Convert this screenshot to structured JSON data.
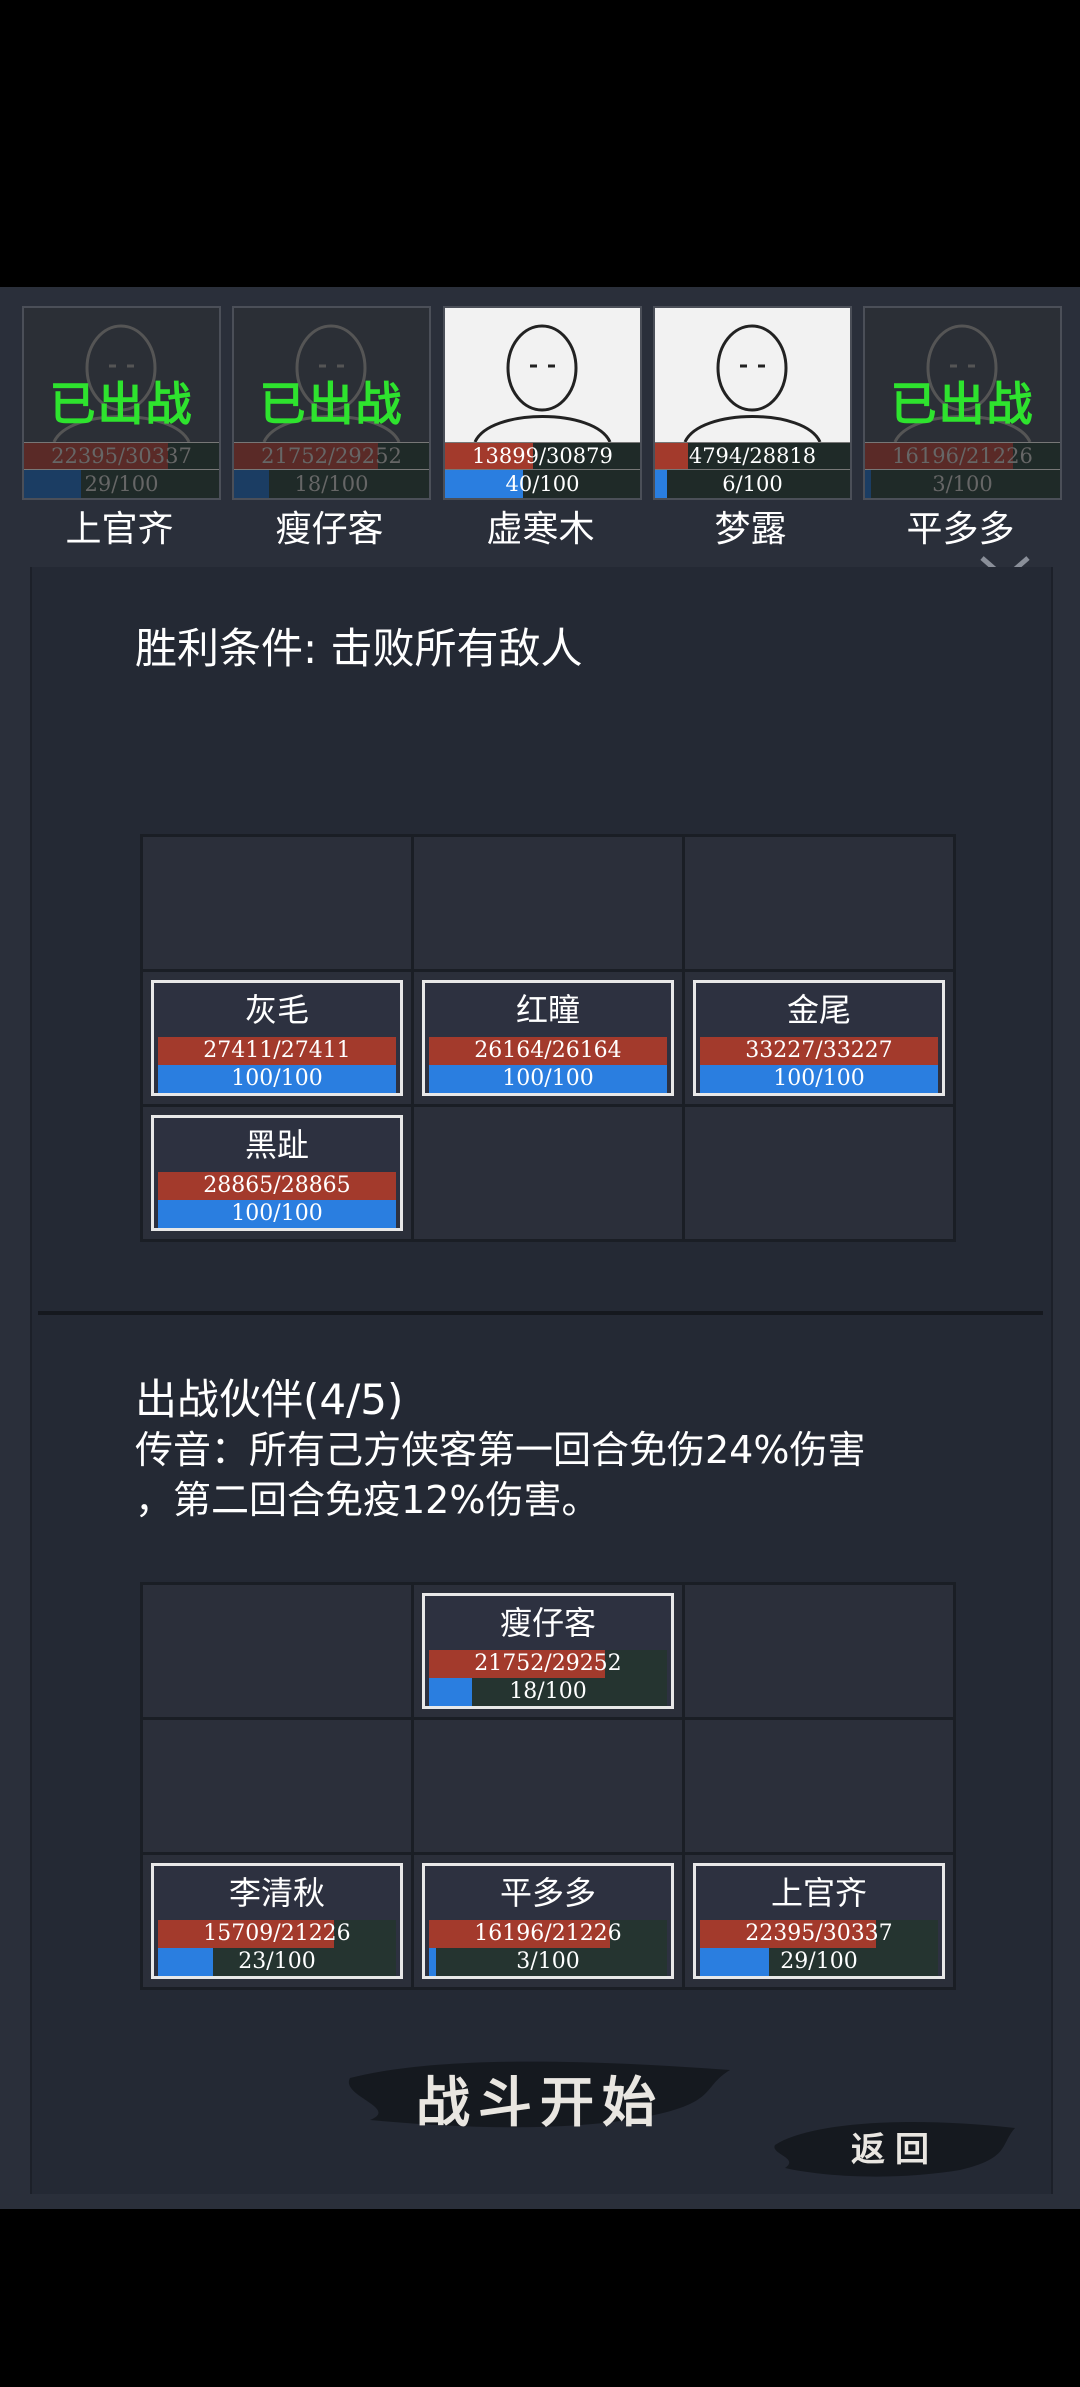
{
  "roster": [
    {
      "name": "上官齐",
      "hp": "22395/30337",
      "hp_frac": 0.74,
      "rage": "29/100",
      "rage_frac": 0.29,
      "deployed": true,
      "stamp": "已出战"
    },
    {
      "name": "瘦仔客",
      "hp": "21752/29252",
      "hp_frac": 0.74,
      "rage": "18/100",
      "rage_frac": 0.18,
      "deployed": true,
      "stamp": "已出战"
    },
    {
      "name": "虚寒木",
      "hp": "13899/30879",
      "hp_frac": 0.45,
      "rage": "40/100",
      "rage_frac": 0.4,
      "deployed": false,
      "stamp": ""
    },
    {
      "name": "梦露",
      "hp": "4794/28818",
      "hp_frac": 0.17,
      "rage": "6/100",
      "rage_frac": 0.06,
      "deployed": false,
      "stamp": ""
    },
    {
      "name": "平多多",
      "hp": "16196/21226",
      "hp_frac": 0.76,
      "rage": "3/100",
      "rage_frac": 0.03,
      "deployed": true,
      "stamp": "已出战"
    }
  ],
  "victory": {
    "text": "胜利条件: 击败所有敌人"
  },
  "enemies": [
    null,
    null,
    null,
    {
      "name": "灰毛",
      "hp": "27411/27411",
      "hp_frac": 1.0,
      "rage": "100/100",
      "rage_frac": 1.0
    },
    {
      "name": "红瞳",
      "hp": "26164/26164",
      "hp_frac": 1.0,
      "rage": "100/100",
      "rage_frac": 1.0
    },
    {
      "name": "金尾",
      "hp": "33227/33227",
      "hp_frac": 1.0,
      "rage": "100/100",
      "rage_frac": 1.0
    },
    {
      "name": "黑趾",
      "hp": "28865/28865",
      "hp_frac": 1.0,
      "rage": "100/100",
      "rage_frac": 1.0
    },
    null,
    null
  ],
  "party": {
    "title": "出战伙伴(4/5)",
    "buff_line1": "传音：所有己方侠客第一回合免伤24%伤害",
    "buff_line2": "，第二回合免疫12%伤害。"
  },
  "allies": [
    null,
    {
      "name": "瘦仔客",
      "hp": "21752/29252",
      "hp_frac": 0.74,
      "rage": "18/100",
      "rage_frac": 0.18
    },
    null,
    null,
    null,
    null,
    {
      "name": "李清秋",
      "hp": "15709/21226",
      "hp_frac": 0.74,
      "rage": "23/100",
      "rage_frac": 0.23
    },
    {
      "name": "平多多",
      "hp": "16196/21226",
      "hp_frac": 0.76,
      "rage": "3/100",
      "rage_frac": 0.03
    },
    {
      "name": "上官齐",
      "hp": "22395/30337",
      "hp_frac": 0.74,
      "rage": "29/100",
      "rage_frac": 0.29
    }
  ],
  "buttons": {
    "start": "战斗开始",
    "back": "返回"
  }
}
